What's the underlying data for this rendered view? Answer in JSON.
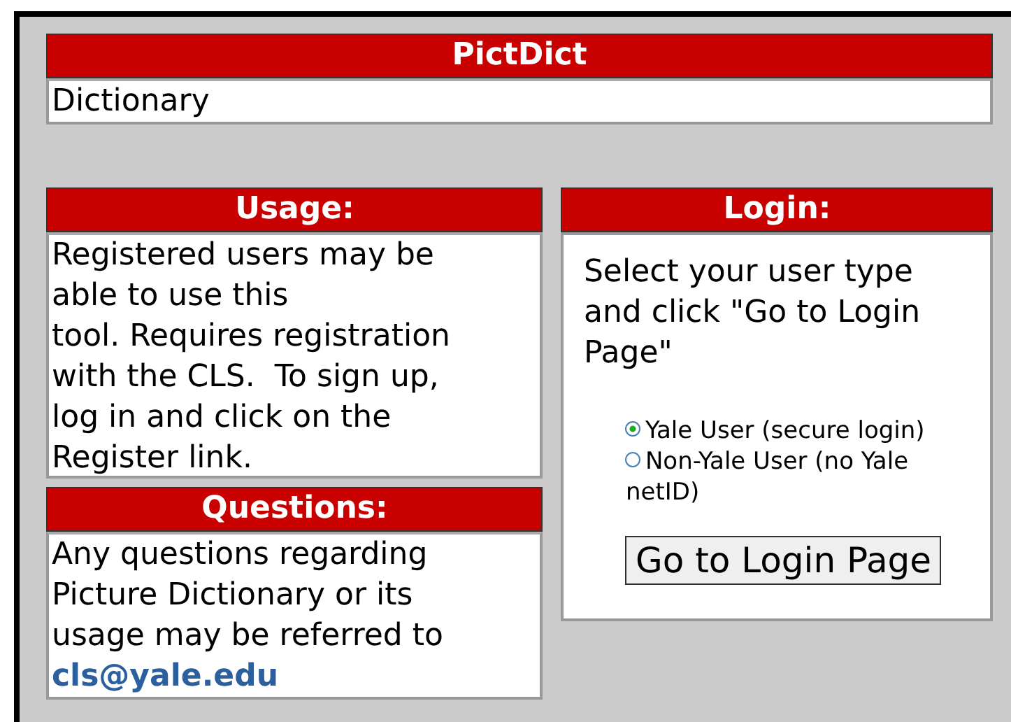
{
  "header": {
    "title": "PictDict",
    "subtitle": "Dictionary"
  },
  "usage": {
    "title": "Usage:",
    "text": "Registered users may be\nable to use this\ntool. Requires registration\nwith the CLS.  To sign up,\nlog in and click on the\nRegister link."
  },
  "questions": {
    "title": "Questions:",
    "text": "Any questions regarding\nPicture Dictionary or its\nusage may be referred to",
    "link": "cls@yale.edu"
  },
  "login": {
    "title": "Login:",
    "instructions": "Select your user type\nand click \"Go to Login\nPage\"",
    "options": [
      {
        "label": "Yale User (secure login)",
        "selected": true
      },
      {
        "label": "Non-Yale User (no Yale netID)",
        "selected": false
      }
    ],
    "button": "Go to Login Page"
  }
}
